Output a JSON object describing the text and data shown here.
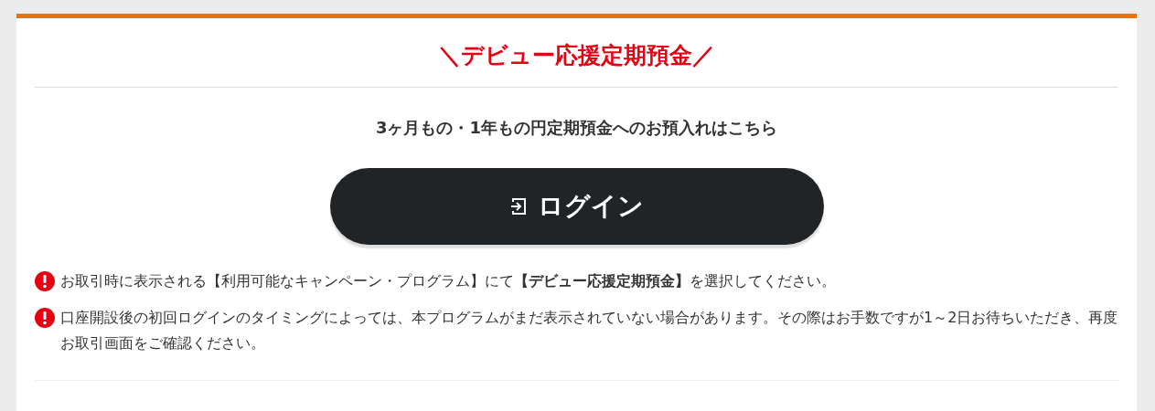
{
  "title": "＼デビュー応援定期預金／",
  "subtitle": "3ヶ月もの・1年もの円定期預金へのお預入れはこちら",
  "login_button": {
    "label": "ログイン"
  },
  "notes": [
    {
      "text": "お取引時に表示される【利用可能なキャンペーン・プログラム】にて**【デビュー応援定期預金】**を選択してください。"
    },
    {
      "text": "口座開設後の初回ログインのタイミングによっては、本プログラムがまだ表示されていない場合があります。その際はお手数ですが1～2日お待ちいただき、再度お取引画面をご確認ください。"
    }
  ]
}
